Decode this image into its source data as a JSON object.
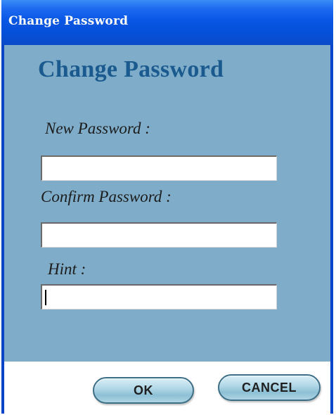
{
  "window": {
    "title": "Change Password"
  },
  "dialog": {
    "heading": "Change Password",
    "fields": {
      "new_password": {
        "label": "New Password :",
        "value": ""
      },
      "confirm_password": {
        "label": "Confirm Password :",
        "value": ""
      },
      "hint": {
        "label": "Hint :",
        "value": ""
      }
    }
  },
  "buttons": {
    "ok_label": "OK",
    "cancel_label": "CANCEL"
  },
  "colors": {
    "titlebar": "#0856e4",
    "content_background": "#7fadc9",
    "heading_text": "#1a5a8e",
    "button_fill": "#b3d9e8",
    "button_border": "#3c6f86"
  }
}
